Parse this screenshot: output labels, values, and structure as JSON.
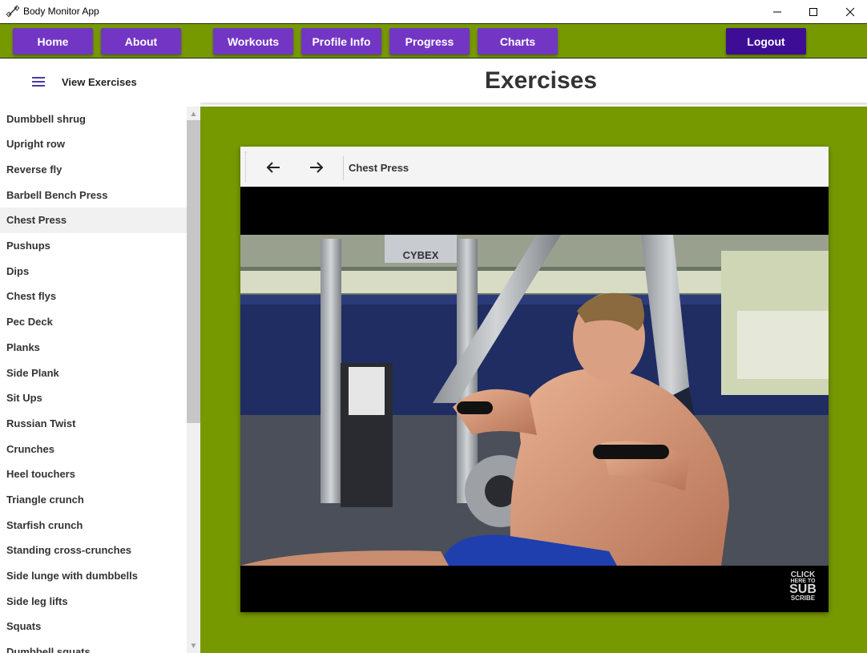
{
  "window": {
    "title": "Body Monitor App"
  },
  "nav": {
    "items": [
      {
        "label": "Home"
      },
      {
        "label": "About"
      },
      {
        "label": "Workouts"
      },
      {
        "label": "Profile Info"
      },
      {
        "label": "Progress"
      },
      {
        "label": "Charts"
      }
    ],
    "logout_label": "Logout",
    "bar_color": "#779900",
    "button_color": "#7336c4",
    "logout_color": "#3d0d96"
  },
  "header": {
    "view_label": "View Exercises",
    "page_title": "Exercises"
  },
  "sidebar": {
    "items": [
      "Dumbbell shrug",
      "Upright row",
      "Reverse fly",
      "Barbell Bench Press",
      "Chest Press",
      "Pushups",
      "Dips",
      "Chest flys",
      "Pec Deck",
      "Planks",
      "Side Plank",
      "Sit Ups",
      "Russian Twist",
      "Crunches",
      "Heel touchers",
      "Triangle crunch",
      "Starfish crunch",
      "Standing cross-crunches",
      "Side lunge with dumbbells",
      "Side leg lifts",
      "Squats",
      "Dumbbell squats"
    ],
    "selected": "Chest Press"
  },
  "viewer": {
    "title": "Chest Press",
    "back_icon": "arrow-left-icon",
    "forward_icon": "arrow-right-icon",
    "badge": {
      "line1": "CLICK",
      "line2": "HERE TO",
      "line3": "SUB",
      "line4": "SCRIBE"
    },
    "machine_label": "CYBEX"
  }
}
